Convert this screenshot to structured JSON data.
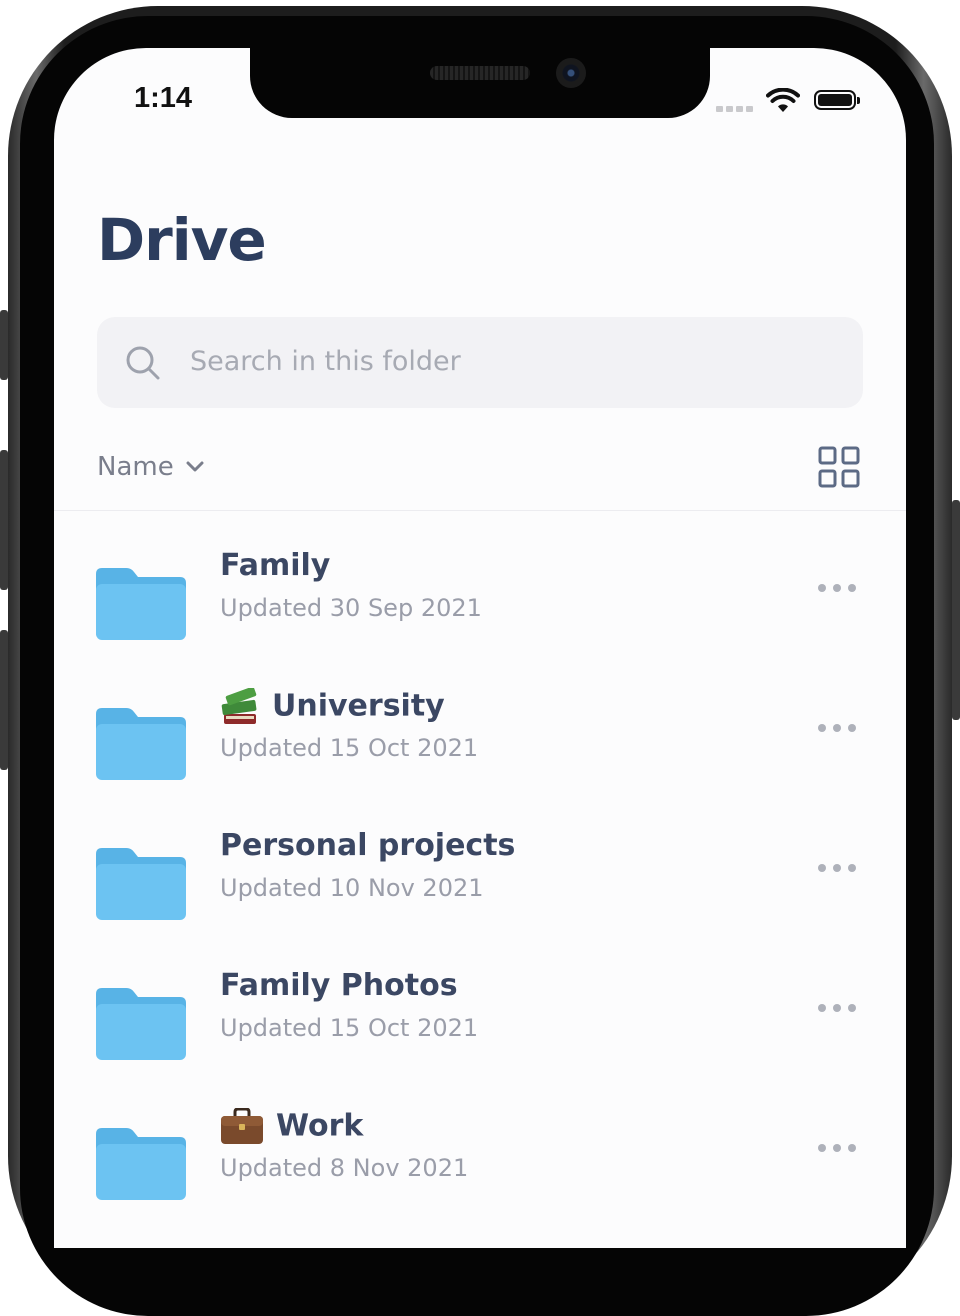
{
  "status_bar": {
    "time": "1:14"
  },
  "page": {
    "title": "Drive"
  },
  "search": {
    "placeholder": "Search in this folder"
  },
  "sort": {
    "label": "Name"
  },
  "colors": {
    "title": "#2c3d5e",
    "folder": "#6cc3f2",
    "folder_tab": "#58b3e6",
    "secondary_text": "#9a9da9"
  },
  "folders": [
    {
      "name": "Family",
      "emoji_icon": "",
      "updated": "Updated 30 Sep 2021"
    },
    {
      "name": "University",
      "emoji_icon": "books-icon",
      "updated": "Updated 15 Oct 2021"
    },
    {
      "name": "Personal projects",
      "emoji_icon": "",
      "updated": "Updated 10 Nov 2021"
    },
    {
      "name": "Family Photos",
      "emoji_icon": "",
      "updated": "Updated 15 Oct 2021"
    },
    {
      "name": "Work",
      "emoji_icon": "briefcase-icon",
      "updated": "Updated 8 Nov 2021"
    }
  ]
}
